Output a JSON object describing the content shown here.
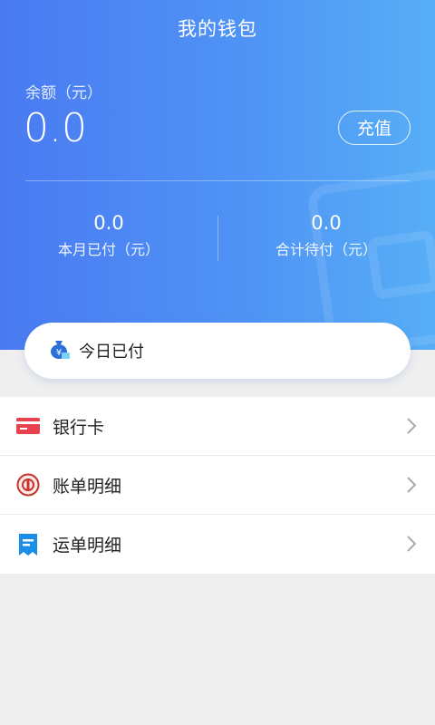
{
  "header": {
    "title": "我的钱包",
    "balance_label": "余额（元）",
    "balance_value": "0.0",
    "recharge_label": "充值",
    "stats": [
      {
        "value": "0.0",
        "label": "本月已付（元）"
      },
      {
        "value": "0.0",
        "label": "合计待付（元）"
      }
    ]
  },
  "today": {
    "label": "今日已付",
    "icon": "money-bag-icon"
  },
  "menu": {
    "items": [
      {
        "label": "银行卡",
        "icon": "bank-card-icon"
      },
      {
        "label": "账单明细",
        "icon": "bill-detail-icon"
      },
      {
        "label": "运单明细",
        "icon": "waybill-icon"
      }
    ]
  },
  "colors": {
    "header_gradient_start": "#4a7af2",
    "header_gradient_end": "#57aef6",
    "card_icon_red": "#e8424f",
    "bill_icon_red": "#c8322b",
    "waybill_icon_blue": "#1b8fe8"
  }
}
